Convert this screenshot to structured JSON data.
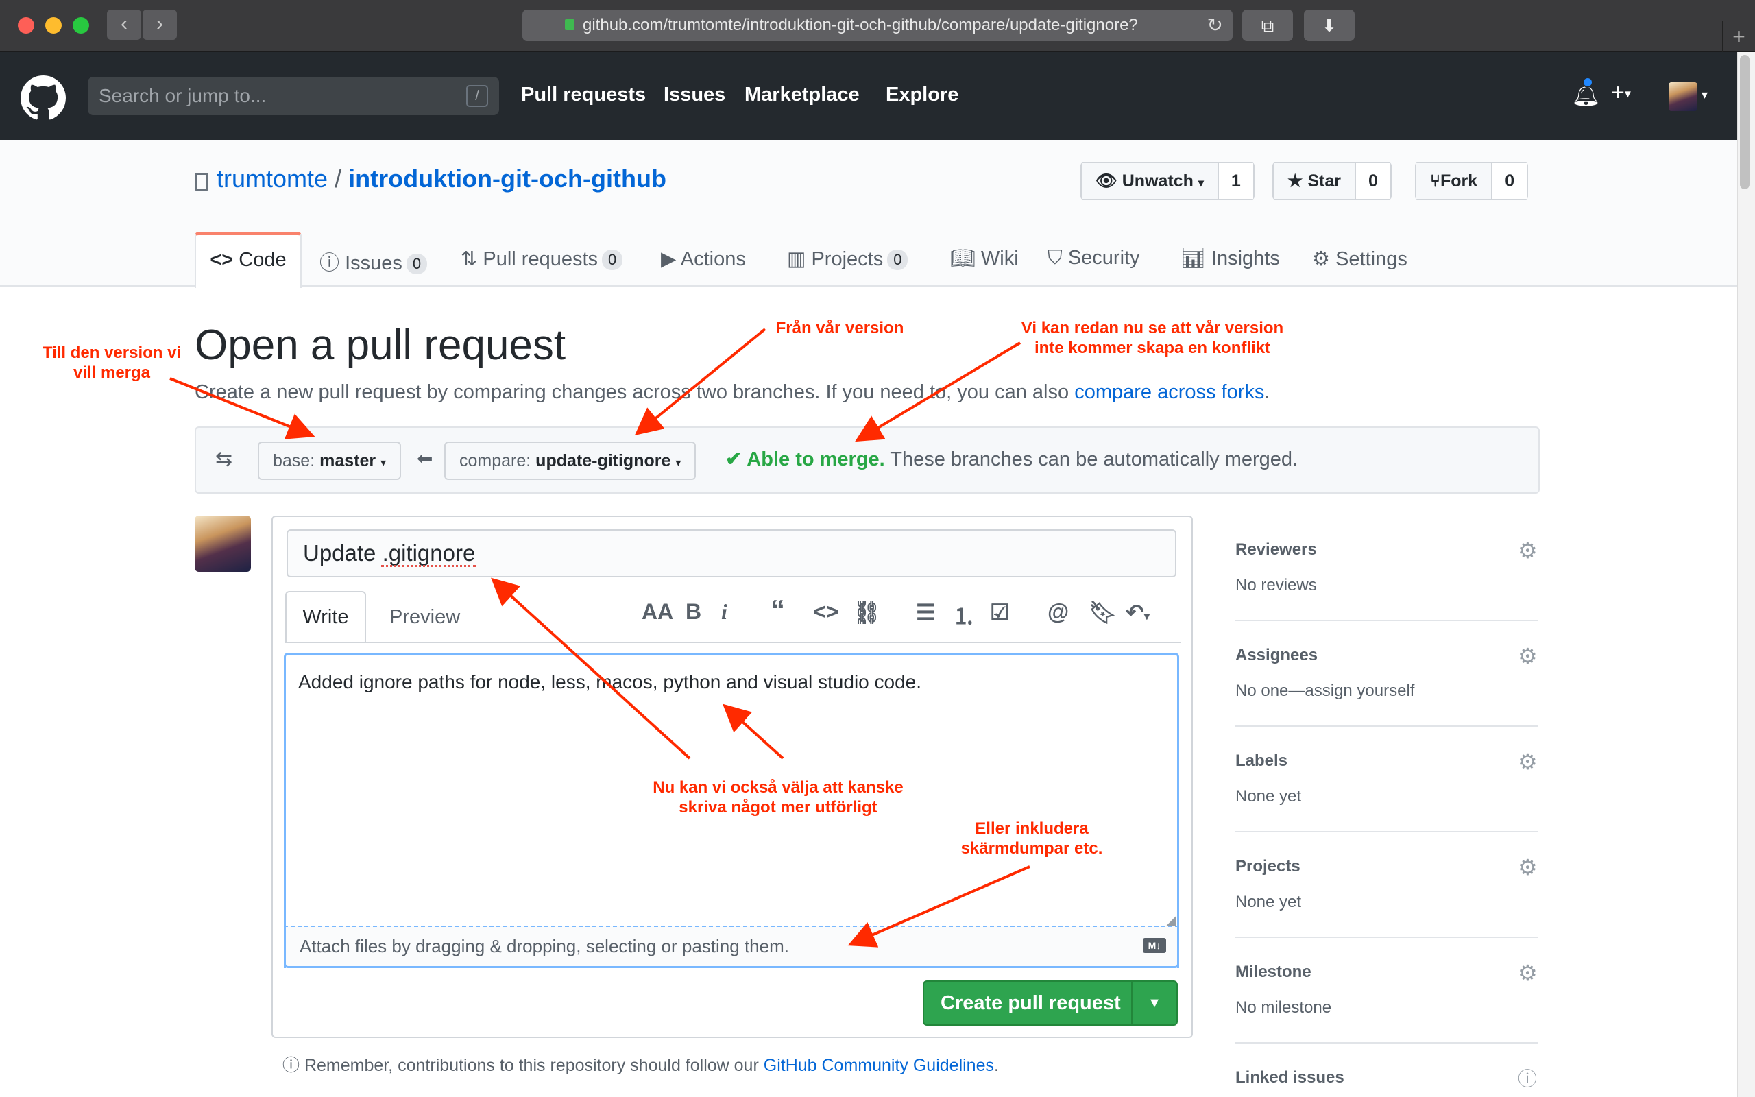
{
  "browser": {
    "url": "github.com/trumtomte/introduktion-git-och-github/compare/update-gitignore?"
  },
  "header": {
    "search_placeholder": "Search or jump to...",
    "slash": "/",
    "nav": [
      "Pull requests",
      "Issues",
      "Marketplace",
      "Explore"
    ]
  },
  "repo": {
    "owner": "trumtomte",
    "separator": "/",
    "name": "introduktion-git-och-github",
    "unwatch_label": "Unwatch",
    "unwatch_count": "1",
    "star_label": "Star",
    "star_count": "0",
    "fork_label": "Fork",
    "fork_count": "0",
    "tabs": [
      {
        "label": "Code"
      },
      {
        "label": "Issues",
        "count": "0"
      },
      {
        "label": "Pull requests",
        "count": "0"
      },
      {
        "label": "Actions"
      },
      {
        "label": "Projects",
        "count": "0"
      },
      {
        "label": "Wiki"
      },
      {
        "label": "Security"
      },
      {
        "label": "Insights"
      },
      {
        "label": "Settings"
      }
    ]
  },
  "main": {
    "title": "Open a pull request",
    "subtitle": "Create a new pull request by comparing changes across two branches. If you need to, you can also",
    "subtitle_link": "compare across forks",
    "subtitle_end": ".",
    "base_prefix": "base:",
    "base_branch": "master",
    "compare_prefix": "compare:",
    "compare_branch": "update-gitignore",
    "merge_status": "Able to merge.",
    "merge_detail": "These branches can be automatically merged."
  },
  "form": {
    "pr_title": "Update .gitignore",
    "tab_write": "Write",
    "tab_preview": "Preview",
    "body": "Added ignore paths for node, less, macos, python and visual studio code.",
    "attach_hint": "Attach files by dragging & dropping, selecting or pasting them.",
    "markdown_badge": "M↓",
    "create_button": "Create pull request",
    "remember_text": "Remember, contributions to this repository should follow our",
    "remember_link": "GitHub Community Guidelines",
    "remember_end": "."
  },
  "sidebar": {
    "sections": [
      {
        "title": "Reviewers",
        "value": "No reviews"
      },
      {
        "title": "Assignees",
        "value": "No one—assign yourself"
      },
      {
        "title": "Labels",
        "value": "None yet"
      },
      {
        "title": "Projects",
        "value": "None yet"
      },
      {
        "title": "Milestone",
        "value": "No milestone"
      },
      {
        "title": "Linked issues",
        "value": ""
      }
    ]
  },
  "annotations": {
    "left_1": "Till den version vi",
    "left_2": "vill merga",
    "from_1": "Från vår version",
    "conflict_1": "Vi kan redan nu se att vår version",
    "conflict_2": "inte kommer skapa en konflikt",
    "body_1": "Nu kan vi också välja att kanske",
    "body_2": "skriva något mer utförligt",
    "attach_1": "Eller inkludera",
    "attach_2": "skärmdumpar etc."
  },
  "colors": {
    "accent_red": "#ff2a00",
    "merge_green": "#28a745",
    "link_blue": "#0366d6"
  }
}
